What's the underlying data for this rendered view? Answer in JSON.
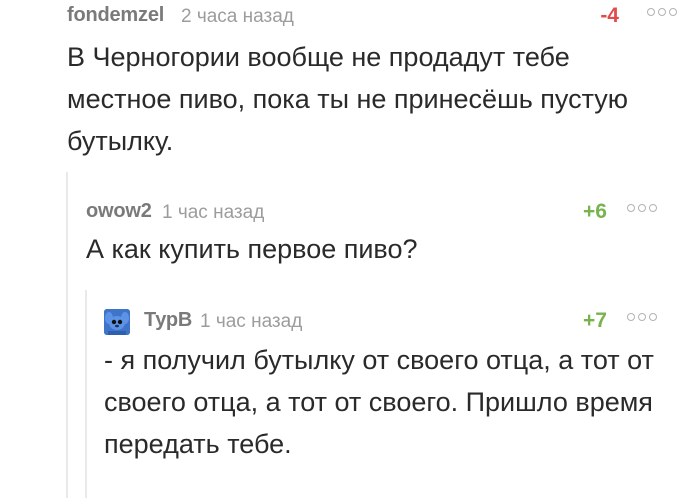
{
  "comments": [
    {
      "author": "fondemzel",
      "time": "2 часа назад",
      "rating": "-4",
      "text": "В Черногории вообще не продадут тебе местное пиво, пока ты не принесёшь пустую бутылку."
    },
    {
      "author": "owow2",
      "time": "1 час назад",
      "rating": "+6",
      "text": "А как купить первое пиво?"
    },
    {
      "author": "ТурВ",
      "time": "1 час назад",
      "rating": "+7",
      "text": "- я получил бутылку от своего отца, а тот от своего отца, а тот от своего. Пришло время передать тебе."
    }
  ],
  "colors": {
    "negative": "#e34b4b",
    "positive": "#79b350",
    "author": "#7a7a7a",
    "thread_line": "#e9e9e9"
  }
}
